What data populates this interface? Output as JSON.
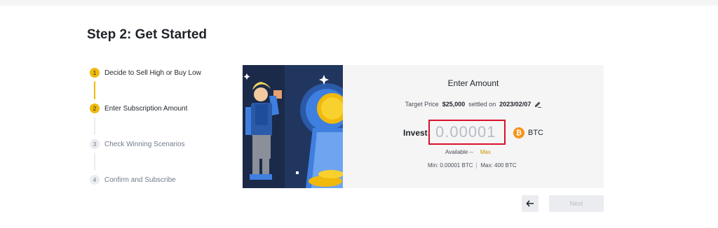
{
  "page": {
    "title": "Step 2: Get Started"
  },
  "steps": [
    {
      "number": "1",
      "label": "Decide to Sell High or Buy Low",
      "state": "done"
    },
    {
      "number": "2",
      "label": "Enter Subscription Amount",
      "state": "active"
    },
    {
      "number": "3",
      "label": "Check Winning Scenarios",
      "state": "pending"
    },
    {
      "number": "4",
      "label": "Confirm and Subscribe",
      "state": "pending"
    }
  ],
  "panel": {
    "title": "Enter Amount",
    "target_price_label": "Target Price",
    "target_price_value": "$25,000",
    "settled_on_label": "settled on",
    "settled_date": "2023/02/07",
    "edit_icon": "pencil-icon",
    "invest_label": "Invest",
    "amount_placeholder": "0.00001",
    "currency": "BTC",
    "currency_icon": "bitcoin-icon",
    "currency_symbol": "₿",
    "available_label": "Available --",
    "max_label": "Max",
    "min_label": "Min: 0.00001 BTC",
    "max_limit_label": "Max: 400 BTC"
  },
  "nav": {
    "back_icon": "arrow-left-icon",
    "next_label": "Next"
  },
  "colors": {
    "accent": "#f0b90b",
    "input_border": "#d9112a",
    "bitcoin": "#f7931a",
    "panel_bg": "#f5f5f5",
    "illustration_bg": "#1b2a48"
  }
}
